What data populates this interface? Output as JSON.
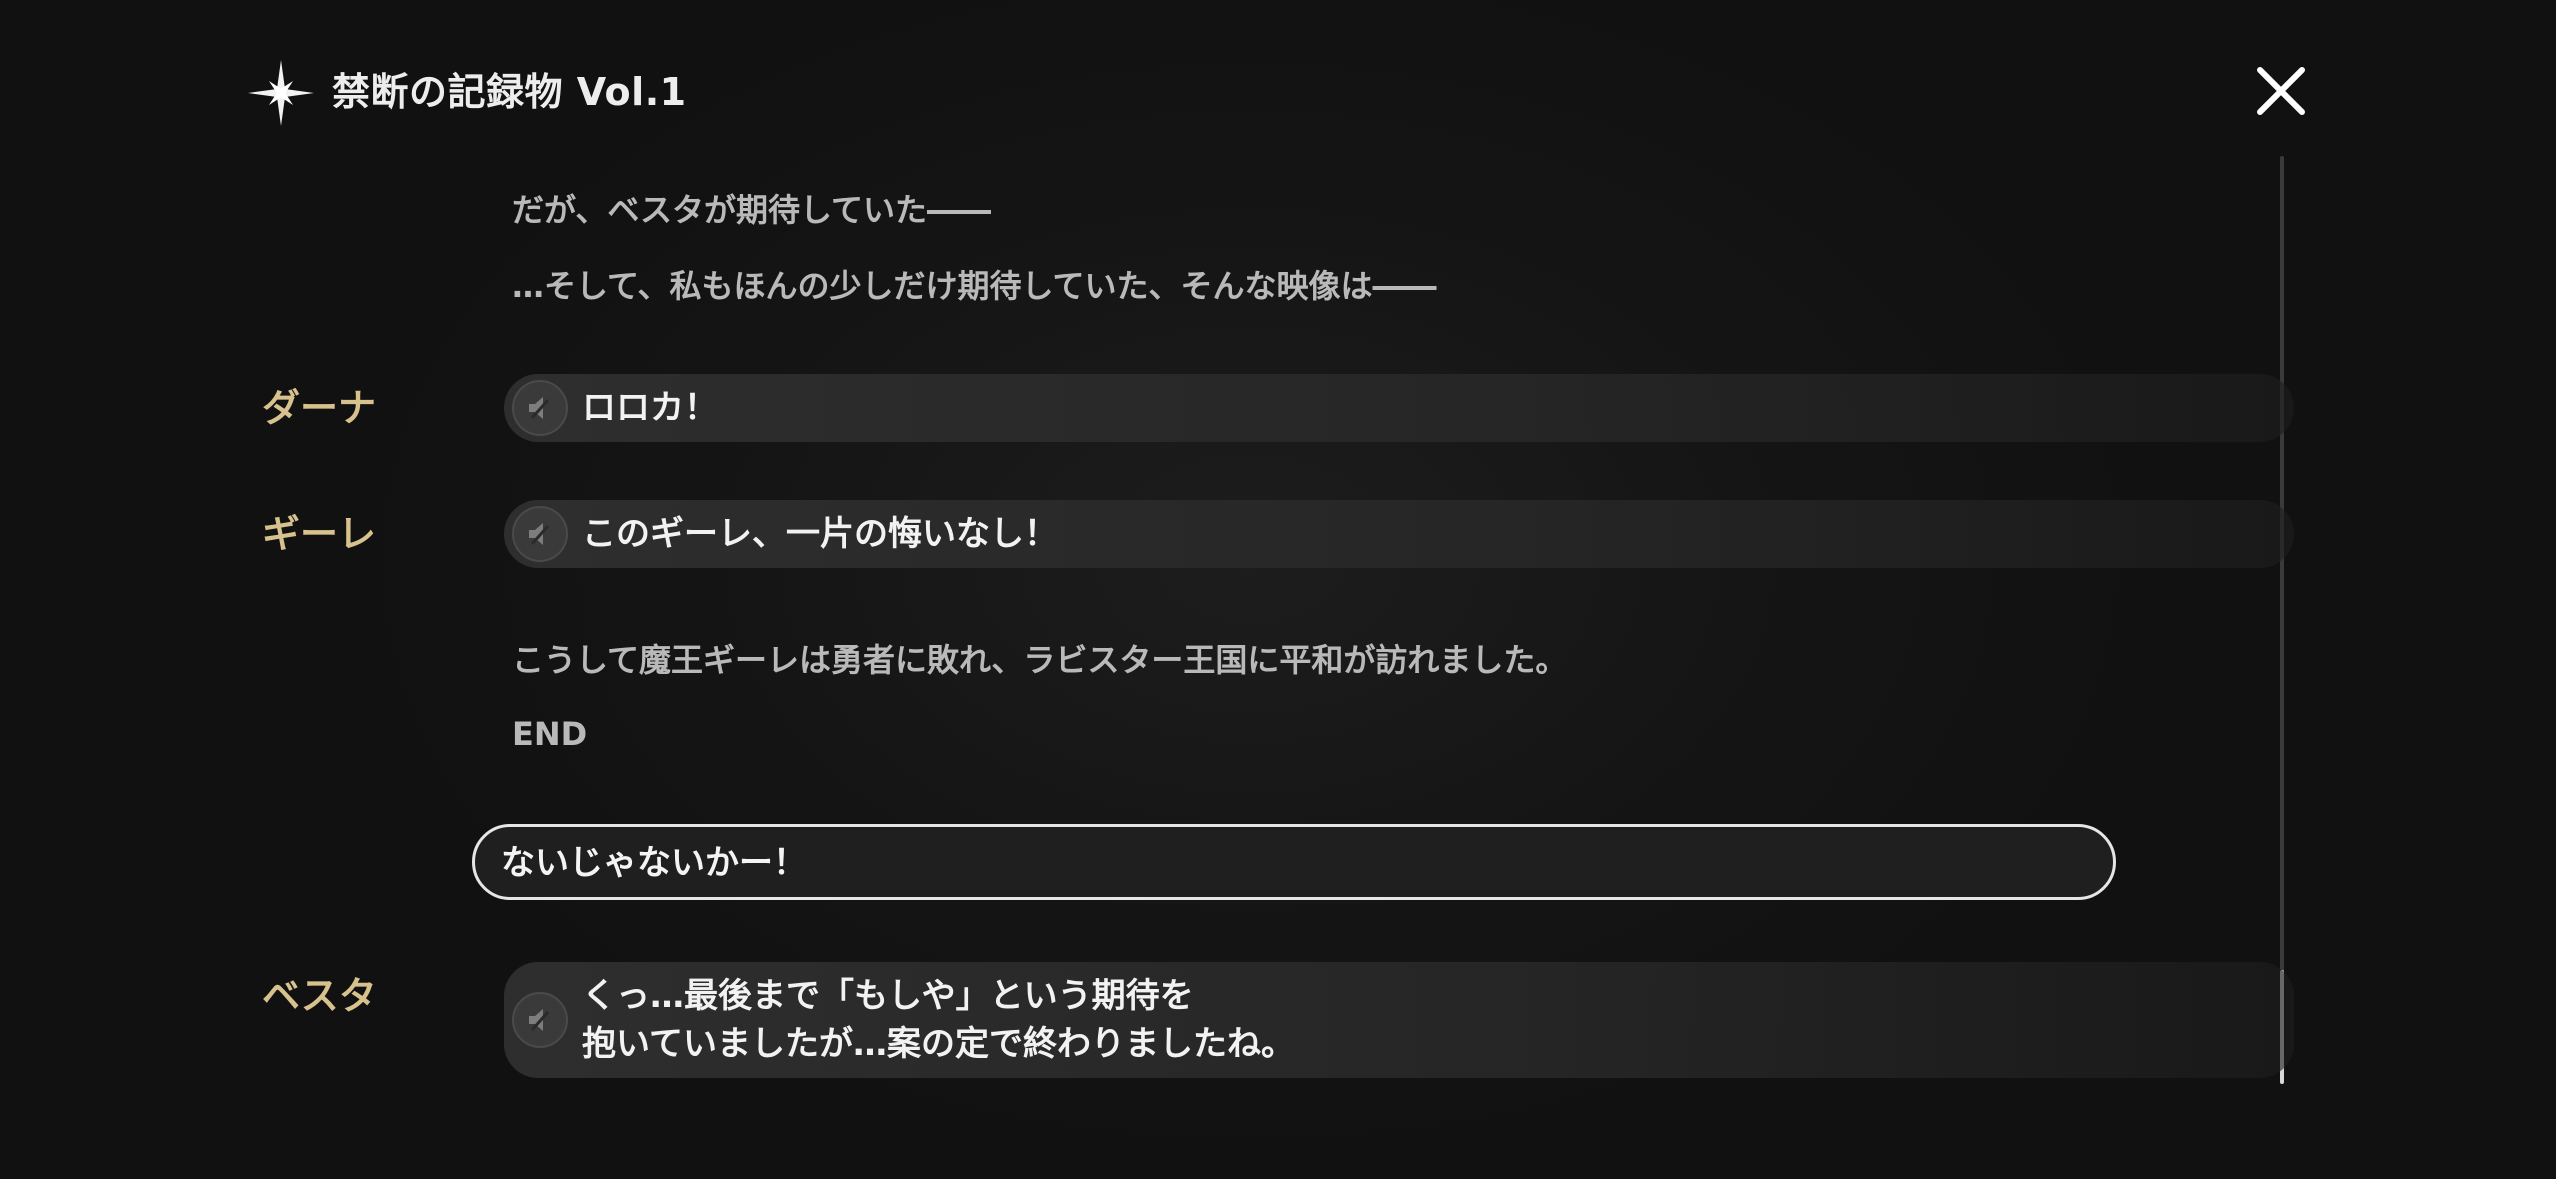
{
  "header": {
    "title": "禁断の記録物 Vol.1",
    "star_icon": "sparkle-icon",
    "close_icon": "close-icon"
  },
  "log": {
    "narration_1": "だが、ベスタが期待していた――",
    "narration_2": "…そして、私もほんの少しだけ期待していた、そんな映像は――",
    "dialogue_1": {
      "speaker": "ダーナ",
      "text": "ロロカ！"
    },
    "dialogue_2": {
      "speaker": "ギーレ",
      "text": "このギーレ、一片の悔いなし！"
    },
    "narration_3": "こうして魔王ギーレは勇者に敗れ、ラビスター王国に平和が訪れました。",
    "narration_4": "END",
    "choice": "ないじゃないかー！",
    "dialogue_3": {
      "speaker": "ベスタ",
      "line_1": "くっ…最後まで「もしや」という期待を",
      "line_2": "抱いていましたが…案の定で終わりましたね。"
    }
  },
  "colors": {
    "speaker": "#d7c28e",
    "narration": "#b9b9b9",
    "background": "#121212"
  },
  "voice_icon": "speaker-muted-icon"
}
